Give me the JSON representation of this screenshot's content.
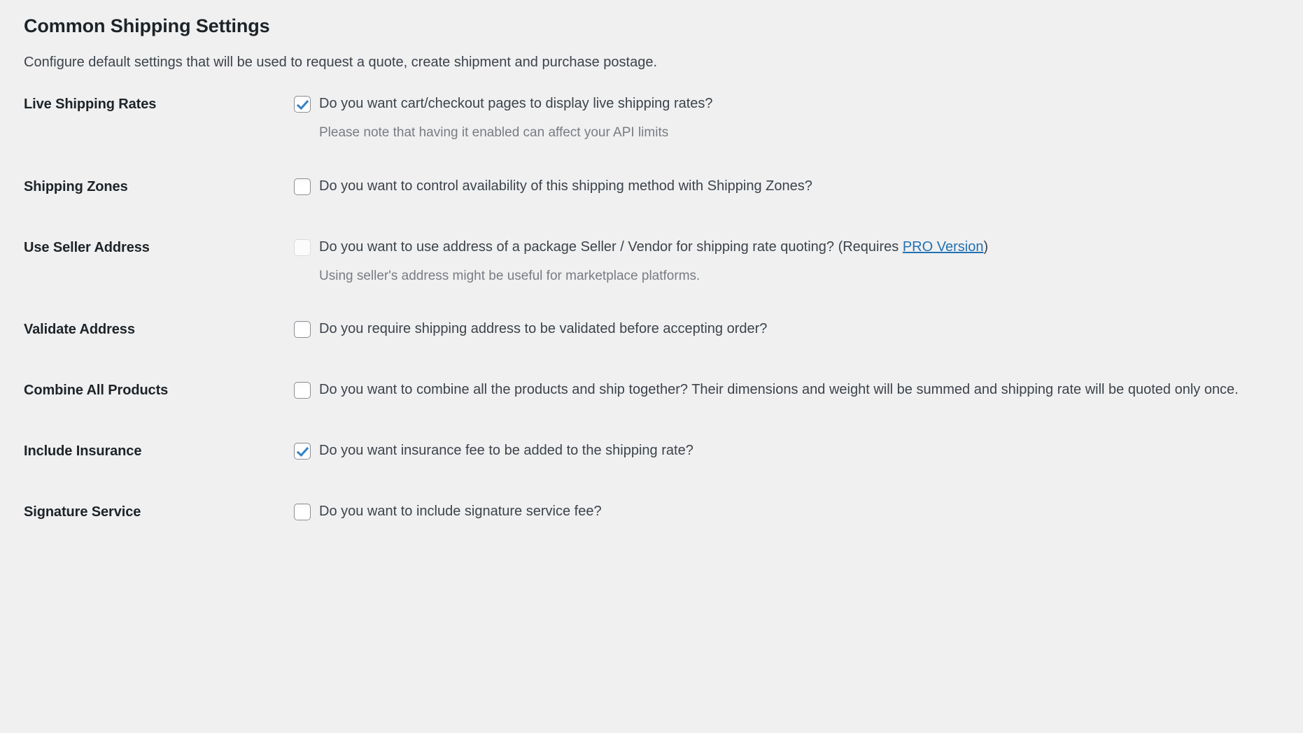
{
  "section": {
    "title": "Common Shipping Settings",
    "subtitle": "Configure default settings that will be used to request a quote, create shipment and purchase postage."
  },
  "colors": {
    "background": "#f0f0f1",
    "heading": "#1d2327",
    "body_text": "#3c434a",
    "help_text": "#787c82",
    "link": "#2271b1",
    "checkbox_border": "#8c8f94",
    "checkbox_check": "#3582c4",
    "checkbox_disabled_border": "#dcdcde"
  },
  "rows": [
    {
      "label": "Live Shipping Rates",
      "checkbox": {
        "state": "checked",
        "name": "live-shipping-rates-checkbox"
      },
      "text": "Do you want cart/checkout pages to display live shipping rates?",
      "help": "Please note that having it enabled can affect your API limits"
    },
    {
      "label": "Shipping Zones",
      "checkbox": {
        "state": "unchecked",
        "name": "shipping-zones-checkbox"
      },
      "text": "Do you want to control availability of this shipping method with Shipping Zones?",
      "help": ""
    },
    {
      "label": "Use Seller Address",
      "checkbox": {
        "state": "disabled",
        "name": "use-seller-address-checkbox"
      },
      "text_before_link": "Do you want to use address of a package Seller / Vendor for shipping rate quoting? (Requires ",
      "link_label": "PRO Version",
      "text_after_link": ")",
      "help": "Using seller's address might be useful for marketplace platforms."
    },
    {
      "label": "Validate Address",
      "checkbox": {
        "state": "unchecked",
        "name": "validate-address-checkbox"
      },
      "text": "Do you require shipping address to be validated before accepting order?",
      "help": ""
    },
    {
      "label": "Combine All Products",
      "checkbox": {
        "state": "unchecked",
        "name": "combine-all-products-checkbox"
      },
      "text": "Do you want to combine all the products and ship together? Their dimensions and weight will be summed and shipping rate will be quoted only once.",
      "help": ""
    },
    {
      "label": "Include Insurance",
      "checkbox": {
        "state": "checked",
        "name": "include-insurance-checkbox"
      },
      "text": "Do you want insurance fee to be added to the shipping rate?",
      "help": ""
    },
    {
      "label": "Signature Service",
      "checkbox": {
        "state": "unchecked",
        "name": "signature-service-checkbox"
      },
      "text": "Do you want to include signature service fee?",
      "help": ""
    }
  ]
}
